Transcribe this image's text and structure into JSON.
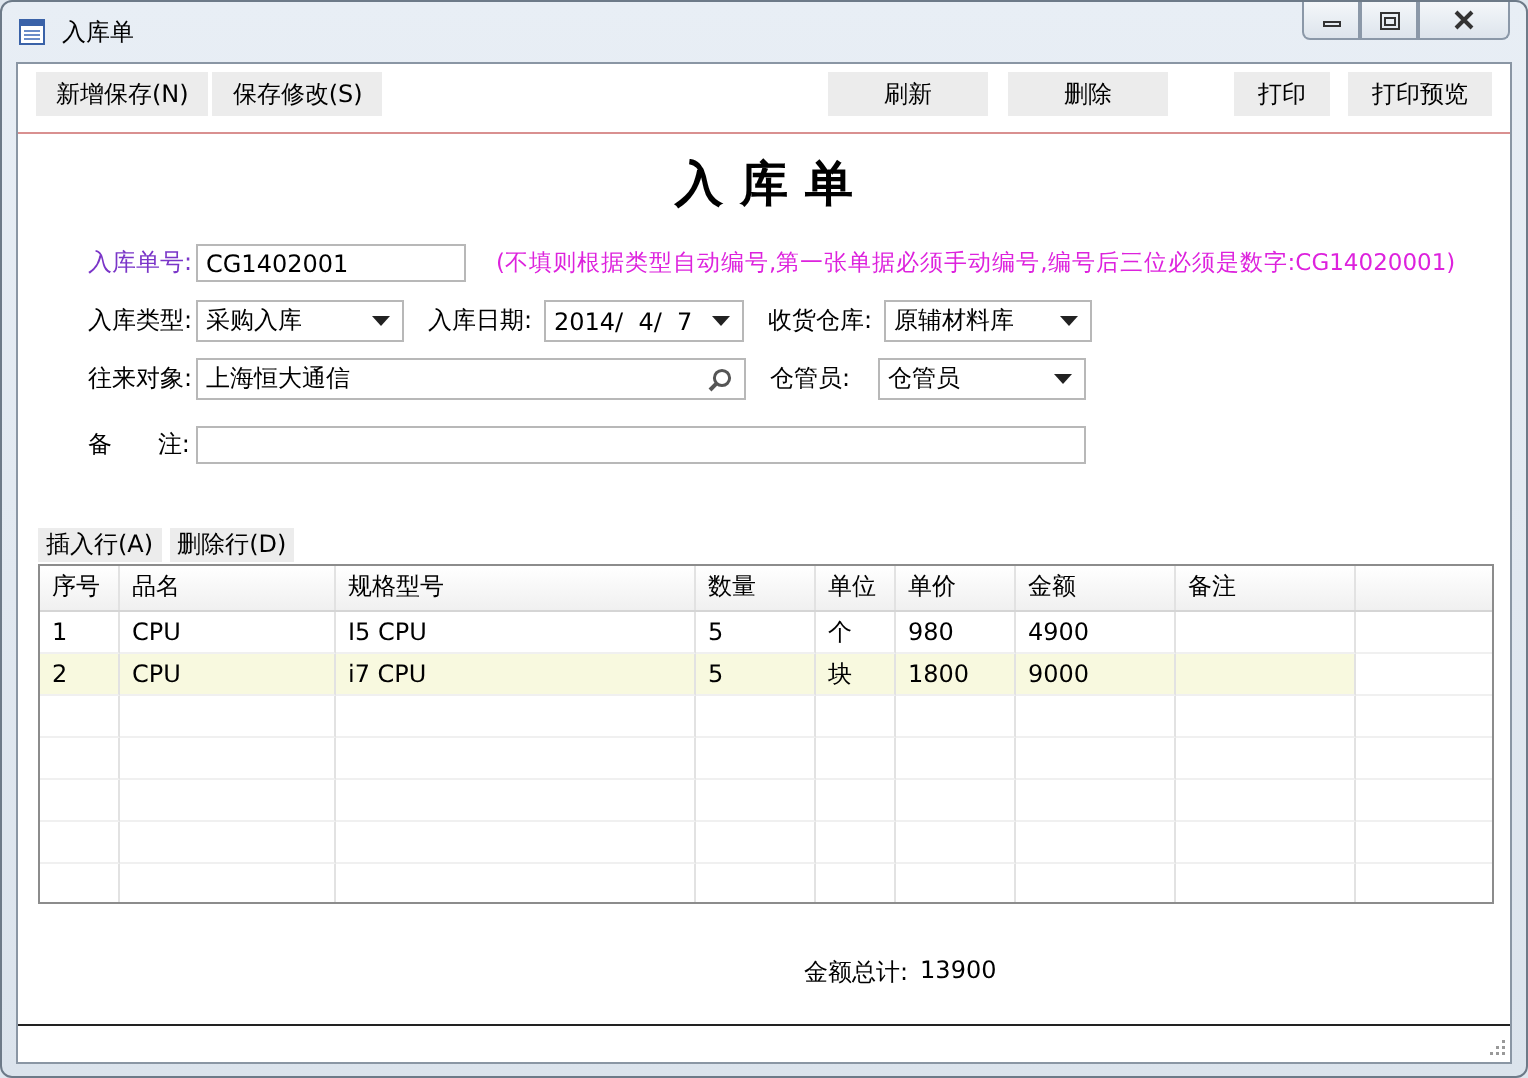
{
  "window": {
    "title": "入库单"
  },
  "toolbar": {
    "left": [
      "新增保存(N)",
      "保存修改(S)"
    ],
    "middle": [
      "刷新",
      "删除"
    ],
    "right": [
      "打印",
      "打印预览"
    ]
  },
  "heading": "入 库 单",
  "form": {
    "number": {
      "label": "入库单号:",
      "value": "CG1402001",
      "hint": "(不填则根据类型自动编号,第一张单据必须手动编号,编号后三位必须是数字:CG14020001)"
    },
    "type": {
      "label": "入库类型:",
      "value": "采购入库"
    },
    "date": {
      "label": "入库日期:",
      "value": "2014/  4/  7"
    },
    "warehouse": {
      "label": "收货仓库:",
      "value": "原辅材料库"
    },
    "partner": {
      "label": "往来对象:",
      "value": "上海恒大通信"
    },
    "keeper": {
      "label": "仓管员:",
      "value": "仓管员"
    },
    "remark": {
      "label": "备      注:"
    }
  },
  "grid_buttons": [
    "插入行(A)",
    "删除行(D)"
  ],
  "table": {
    "columns": [
      "序号",
      "品名",
      "规格型号",
      "数量",
      "单位",
      "单价",
      "金额",
      "备注"
    ],
    "rows": [
      {
        "cells": [
          "1",
          "CPU",
          "I5 CPU",
          "5",
          "个",
          "980",
          "4900"
        ],
        "selected": false
      },
      {
        "cells": [
          "2",
          "CPU",
          "i7 CPU",
          "5",
          "块",
          "1800",
          "9000"
        ],
        "selected": true
      }
    ]
  },
  "total": {
    "label": "金额总计:",
    "value": "13900"
  }
}
